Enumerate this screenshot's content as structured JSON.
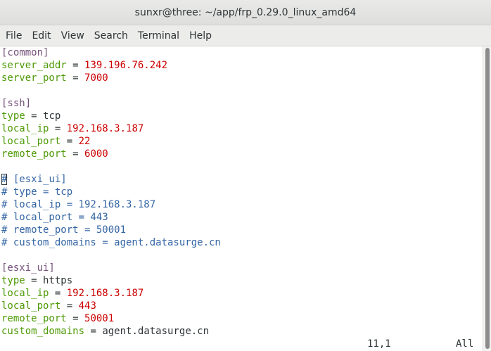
{
  "window": {
    "title": "sunxr@three: ~/app/frp_0.29.0_linux_amd64"
  },
  "menu": [
    "File",
    "Edit",
    "View",
    "Search",
    "Terminal",
    "Help"
  ],
  "editor": {
    "lines": [
      {
        "kind": "section",
        "text": "[common]"
      },
      {
        "kind": "kv",
        "key": "server_addr",
        "value": "139.196.76.242",
        "value_type": "num"
      },
      {
        "kind": "kv",
        "key": "server_port",
        "value": "7000",
        "value_type": "num"
      },
      {
        "kind": "blank"
      },
      {
        "kind": "section",
        "text": "[ssh]"
      },
      {
        "kind": "kv",
        "key": "type",
        "value": "tcp",
        "value_type": "str"
      },
      {
        "kind": "kv",
        "key": "local_ip",
        "value": "192.168.3.187",
        "value_type": "num"
      },
      {
        "kind": "kv",
        "key": "local_port",
        "value": "22",
        "value_type": "num"
      },
      {
        "kind": "kv",
        "key": "remote_port",
        "value": "6000",
        "value_type": "num"
      },
      {
        "kind": "blank"
      },
      {
        "kind": "comment",
        "text": "# [esxi_ui]",
        "cursor": true
      },
      {
        "kind": "comment",
        "text": "# type = tcp"
      },
      {
        "kind": "comment",
        "text": "# local_ip = 192.168.3.187"
      },
      {
        "kind": "comment",
        "text": "# local_port = 443"
      },
      {
        "kind": "comment",
        "text": "# remote_port = 50001"
      },
      {
        "kind": "comment",
        "text": "# custom_domains = agent.datasurge.cn"
      },
      {
        "kind": "blank"
      },
      {
        "kind": "section",
        "text": "[esxi_ui]"
      },
      {
        "kind": "kv",
        "key": "type",
        "value": "https",
        "value_type": "str"
      },
      {
        "kind": "kv",
        "key": "local_ip",
        "value": "192.168.3.187",
        "value_type": "num"
      },
      {
        "kind": "kv",
        "key": "local_port",
        "value": "443",
        "value_type": "num"
      },
      {
        "kind": "kv",
        "key": "remote_port",
        "value": "50001",
        "value_type": "num"
      },
      {
        "kind": "kv",
        "key": "custom_domains",
        "value": "agent.datasurge.cn",
        "value_type": "str"
      }
    ]
  },
  "status": {
    "position": "11,1",
    "scroll": "All"
  },
  "colors": {
    "section": "#75507b",
    "key": "#4e9a06",
    "number": "#cc0000",
    "comment": "#3465a4",
    "text": "#2e3436"
  }
}
